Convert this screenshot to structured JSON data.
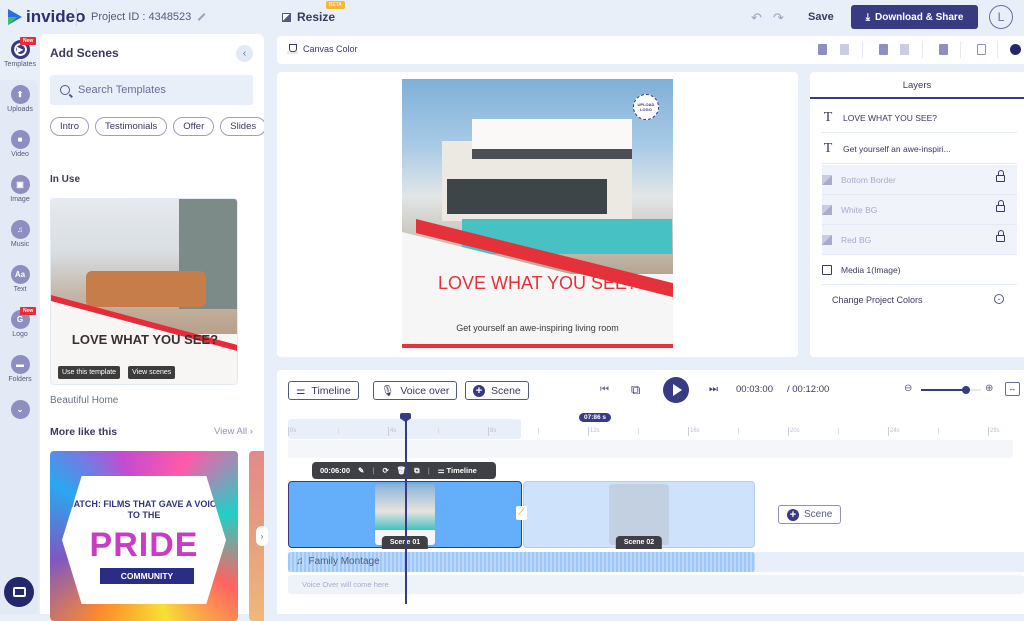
{
  "app": {
    "brand": "invideo",
    "project_id": "Project ID : 4348523",
    "resize_label": "Resize",
    "beta_badge": "BETA"
  },
  "header": {
    "undo_icon": "↶",
    "redo_icon": "↷",
    "save_label": "Save",
    "download_label": "Download & Share",
    "download_icon": "⤓",
    "avatar_initial": "L"
  },
  "rail": {
    "new_badge": "New",
    "items": [
      {
        "label": "Templates",
        "glyph": "▶"
      },
      {
        "label": "Uploads",
        "glyph": "⬆"
      },
      {
        "label": "Video",
        "glyph": "■"
      },
      {
        "label": "Image",
        "glyph": "▣"
      },
      {
        "label": "Music",
        "glyph": "♫"
      },
      {
        "label": "Text",
        "glyph": "Aa"
      },
      {
        "label": "Logo",
        "glyph": "G"
      },
      {
        "label": "Folders",
        "glyph": "▬"
      },
      {
        "label": "",
        "glyph": "⌄"
      }
    ]
  },
  "scenes_panel": {
    "title": "Add Scenes",
    "collapse_icon": "‹",
    "search_placeholder": "Search Templates",
    "chips": [
      "Intro",
      "Testimonials",
      "Offer",
      "Slides"
    ],
    "in_use_title": "In Use",
    "in_use_card": {
      "headline": "LOVE WHAT YOU SEE?",
      "use_button": "Use this template",
      "view_button": "View scenes",
      "name": "Beautiful Home"
    },
    "more_title": "More like this",
    "view_all": "View All ›",
    "pride_card": {
      "line1": "WATCH: FILMS THAT GAVE A VOICE TO THE",
      "line2": "PRIDE",
      "line3": "COMMUNITY"
    },
    "next_icon": "›"
  },
  "canvas_toolbar": {
    "canvas_color_label": "Canvas Color"
  },
  "canvas": {
    "headline": "LOVE WHAT YOU SEE?",
    "subtext": "Get yourself an awe-inspiring living room",
    "upload_logo": "UPLOAD LOGO"
  },
  "layers": {
    "tab": "Layers",
    "items": [
      {
        "name": "LOVE WHAT YOU SEE?",
        "type": "text",
        "locked": false
      },
      {
        "name": "Get yourself an awe-inspiri...",
        "type": "text",
        "locked": false
      },
      {
        "name": "Bottom Border",
        "type": "shape",
        "locked": true
      },
      {
        "name": "White BG",
        "type": "shape",
        "locked": true
      },
      {
        "name": "Red BG",
        "type": "shape",
        "locked": true
      },
      {
        "name": "Media 1(Image)",
        "type": "image",
        "locked": false
      }
    ],
    "change_colors": "Change Project Colors",
    "text_glyph": "T",
    "chevron": "⌄"
  },
  "timeline": {
    "timeline_btn": "Timeline",
    "voiceover_btn": "Voice over",
    "scene_btn": "Scene",
    "current_time": "00:03:00",
    "total_time": "/ 00:12:00",
    "zoom_level": 0.75,
    "playhead_label": "07:86 s",
    "ruler_ticks": [
      "0s",
      "4s",
      "8s",
      "12s",
      "16s",
      "20s",
      "24s",
      "28s"
    ],
    "scene_tools": {
      "duration": "00:06:00",
      "timeline_label": "Timeline"
    },
    "scenes": [
      {
        "label": "Scene 01"
      },
      {
        "label": "Scene 02"
      }
    ],
    "add_scene": "Scene",
    "audio_track": "Family Montage",
    "voice_placeholder": "Voice Over will come here"
  },
  "colors": {
    "accent": "#383a82",
    "brand_red": "#e5323a",
    "scene_selected": "#64aefa"
  }
}
